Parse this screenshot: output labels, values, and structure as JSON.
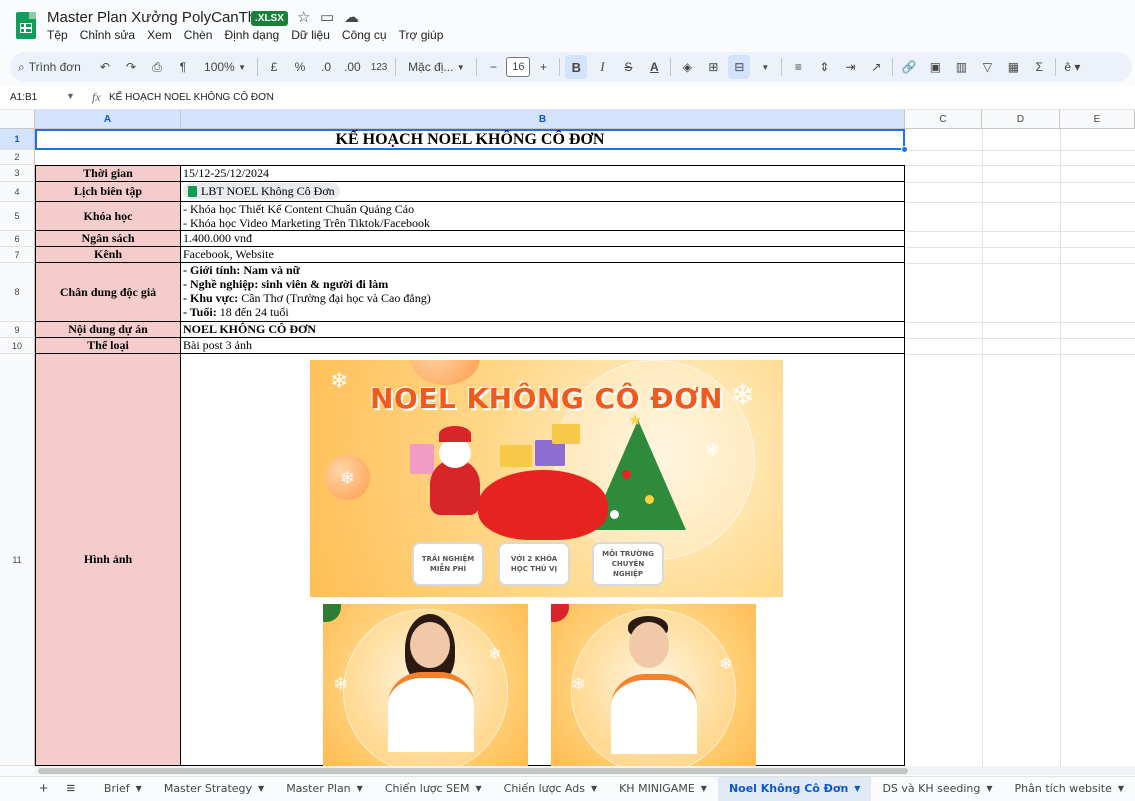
{
  "app": {
    "title": "Master Plan Xưởng PolyCanTho",
    "file_badge": ".XLSX",
    "menu": [
      "Tệp",
      "Chỉnh sửa",
      "Xem",
      "Chèn",
      "Định dạng",
      "Dữ liệu",
      "Công cụ",
      "Trợ giúp"
    ]
  },
  "toolbar": {
    "search": "Trình đơn",
    "zoom": "100%",
    "currency": "£",
    "percent": "%",
    "dec_decrease": ".0",
    "dec_increase": ".00",
    "number_format": "123",
    "font": "Mặc đị...",
    "font_size": "16",
    "bold": "B",
    "italic": "I",
    "strike": "S",
    "text_color": "A",
    "sum": "Σ"
  },
  "formula_bar": {
    "range": "A1:B1",
    "fx": "fx",
    "content": "KẾ HOẠCH NOEL KHÔNG CÔ ĐƠN"
  },
  "columns": [
    "A",
    "B",
    "C",
    "D",
    "E"
  ],
  "rows": [
    "1",
    "2",
    "3",
    "4",
    "5",
    "6",
    "7",
    "8",
    "9",
    "10",
    "11"
  ],
  "sheet": {
    "title": "KẾ HOẠCH NOEL KHÔNG CÔ ĐƠN",
    "time_label": "Thời gian",
    "time_value": "15/12-25/12/2024",
    "editorial_label": "Lịch biên tập",
    "editorial_chip": "LBT NOEL Không Cô Đơn",
    "course_label": "Khóa học",
    "course_1": "- Khóa học Thiết Kế Content Chuẩn Quảng Cáo",
    "course_2": "- Khóa học Video Marketing Trên Tiktok/Facebook",
    "budget_label": "Ngân sách",
    "budget_value": "1.400.000 vnđ",
    "channel_label": "Kênh",
    "channel_value": "Facebook, Website",
    "persona_label": "Chân dung độc giả",
    "persona": {
      "gender_key": "- Giới tính: Nam và nữ",
      "job_key": "- Nghề nghiệp: sinh viên & người đi làm",
      "area_key": "- Khu vực:",
      "area_value": " Cần Thơ (Trường đại học và Cao đẳng)",
      "age_key": "- Tuổi:",
      "age_value": " 18 đến 24 tuổi"
    },
    "content_label": "Nội dung dự án",
    "content_value": "NOEL KHÔNG CÔ ĐƠN",
    "type_label": "Thể loại",
    "type_value": "Bài post 3 ảnh",
    "image_label": "Hình ảnh"
  },
  "poster": {
    "title": "NOEL KHÔNG CÔ ĐƠN",
    "badge_1": "TRẢI NGHIỆM MIỄN PHÍ",
    "badge_2": "VỚI 2 KHÓA HỌC THÚ VỊ",
    "badge_3": "MÔI TRƯỜNG CHUYÊN NGHIỆP"
  },
  "tabs": [
    "Brief",
    "Master Strategy",
    "Master Plan",
    "Chiến lược SEM",
    "Chiến lược Ads",
    "KH MINIGAME",
    "Noel Không Cô Đơn",
    "DS và KH seeding",
    "Phân tích website"
  ],
  "active_tab": "Noel Không Cô Đơn",
  "colors": {
    "label_bg": "#f4cccc",
    "selection": "#1a73e8",
    "poster_orange": "#f05a1a",
    "sheets_green": "#0f9d58"
  }
}
